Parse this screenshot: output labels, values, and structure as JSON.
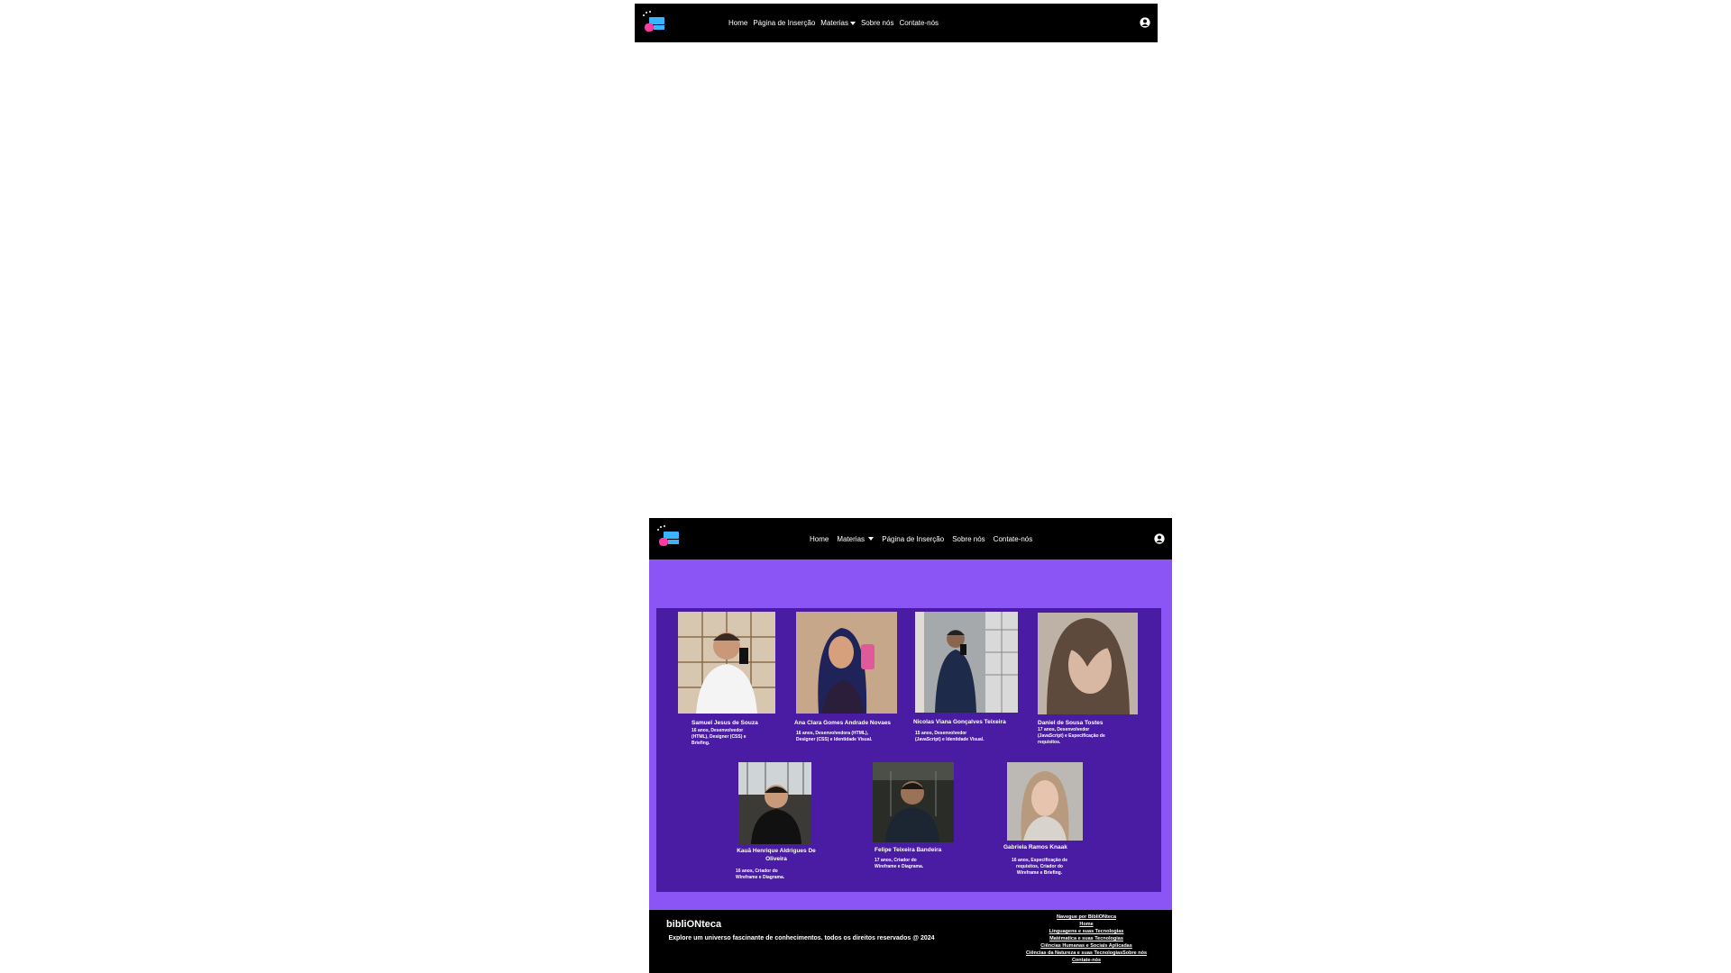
{
  "nav_top": {
    "links": [
      "Home",
      "Página de Inserção",
      "Materias",
      "Sobre nós",
      "Contate-nós"
    ]
  },
  "nav_bottom": {
    "links": [
      "Home",
      "Materias",
      "Página de Inserção",
      "Sobre nós",
      "Contate-nós"
    ]
  },
  "team": [
    {
      "name": "Samuel Jesus de Souza",
      "desc": "16 anos, Desenvolvedor (HTML), Designer (CSS) e Briefing."
    },
    {
      "name": "Ana Clara Gomes Andrade Novaes",
      "desc": "16 anos, Desenvolvedora (HTML), Designer (CSS) e Identidade Visual."
    },
    {
      "name": "Nicolas Viana Gonçalves Teixeira",
      "desc": "15 anos, Desenvolvedor (JavaScript) e Identidade Visual."
    },
    {
      "name": "Daniel de Sousa Tostes",
      "desc": "17 anos, Desenvolvedor (JavaScript) e Especificação de requisitos."
    },
    {
      "name": "Kauã Henrique Aldrigues De Oliveira",
      "desc": "16 anos, Criador do Wireframe e Diagrama."
    },
    {
      "name": "Felipe Teixeira Bandeira",
      "desc": "17 anos, Criador do Wireframe e Diagrama."
    },
    {
      "name": "Gabriela Ramos Knaak",
      "desc": "16 anos, Especificação de requisitos, Criador do Wireframe e Briefing."
    }
  ],
  "footer": {
    "brand": "bibliONteca",
    "tagline": "Explore um universo fascinante de conhecimentos. todos os direitos reservados @ 2024",
    "nav_title": "Navegue por BibliONteca",
    "nav_links": [
      "Home",
      "Linguagens e suas Tecnologias",
      "Matématica e suas Tecnologias",
      "Ciências Humanas e Sociais Aplicadas",
      "Ciências da Natureza e suas TecnologiasSobre nós",
      "Contate-nós"
    ]
  }
}
